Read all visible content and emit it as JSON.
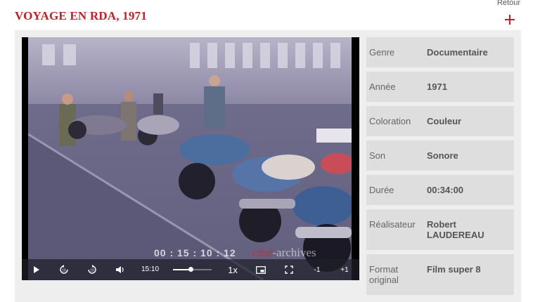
{
  "header": {
    "back_label": "Retour",
    "title": "VOYAGE EN RDA, 1971"
  },
  "video": {
    "burned_timecode": "00 : 15 : 10 : 12",
    "watermark_prefix": "ciné",
    "watermark_suffix": "-archives",
    "controls": {
      "current_time": "15:10",
      "playback_speed": "1x",
      "skip_back_label": "-1",
      "skip_forward_label": "+1",
      "volume_level": 0.45
    }
  },
  "metadata": [
    {
      "label": "Genre",
      "value": "Documentaire"
    },
    {
      "label": "Année",
      "value": "1971"
    },
    {
      "label": "Coloration",
      "value": "Couleur"
    },
    {
      "label": "Son",
      "value": "Sonore"
    },
    {
      "label": "Durée",
      "value": "00:34:00"
    },
    {
      "label": "Réalisateur",
      "value": "Robert LAUDEREAU"
    },
    {
      "label": "Format original",
      "value": "Film super 8"
    }
  ],
  "colors": {
    "accent": "#c41e24",
    "panel": "#eeeeee",
    "row": "#dedede"
  }
}
